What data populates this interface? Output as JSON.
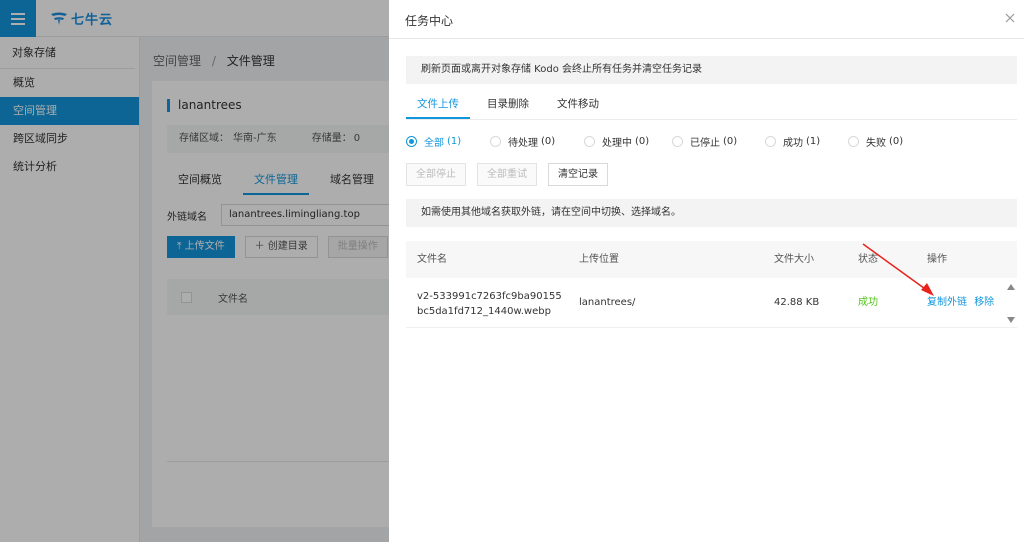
{
  "app": {
    "logo_text": "七牛云"
  },
  "sidebar": {
    "header": "对象存储",
    "items": [
      {
        "label": "概览"
      },
      {
        "label": "空间管理"
      },
      {
        "label": "跨区域同步"
      },
      {
        "label": "统计分析"
      }
    ]
  },
  "breadcrumb": {
    "parent": "空间管理",
    "separator": "/",
    "current": "文件管理"
  },
  "bucket": {
    "name": "lanantrees",
    "region_label": "存储区域：",
    "region": "华南-广东",
    "storage_label": "存储量：",
    "storage": "0"
  },
  "bucket_tabs": [
    "空间概览",
    "文件管理",
    "域名管理"
  ],
  "domain": {
    "label": "外链域名",
    "value": "lanantrees.limingliang.top"
  },
  "bucket_buttons": {
    "upload": "上传文件",
    "mkdir": "创建目录",
    "batch": "批量操作"
  },
  "bucket_table": {
    "col_filename": "文件名"
  },
  "drawer": {
    "title": "任务中心",
    "close_icon": "close-icon",
    "notice": "刷新页面或离开对象存储 Kodo 会终止所有任务并清空任务记录",
    "tabs": [
      "文件上传",
      "目录删除",
      "文件移动"
    ],
    "filters": [
      {
        "label": "全部",
        "count": "(1)"
      },
      {
        "label": "待处理",
        "count": "(0)"
      },
      {
        "label": "处理中",
        "count": "(0)"
      },
      {
        "label": "已停止",
        "count": "(0)"
      },
      {
        "label": "成功",
        "count": "(1)"
      },
      {
        "label": "失败",
        "count": "(0)"
      }
    ],
    "actions": {
      "stop_all": "全部停止",
      "retry_all": "全部重试",
      "clear": "清空记录"
    },
    "tip": "如需使用其他域名获取外链，请在空间中切换、选择域名。",
    "table": {
      "headers": {
        "name": "文件名",
        "location": "上传位置",
        "size": "文件大小",
        "status": "状态",
        "ops": "操作"
      },
      "rows": [
        {
          "name": "v2-533991c7263fc9ba90155bc5da1fd712_1440w.webp",
          "location": "lanantrees/",
          "size": "42.88 KB",
          "status": "成功",
          "op_copy": "复制外链",
          "op_remove": "移除"
        }
      ]
    }
  },
  "colors": {
    "accent": "#1296db",
    "success": "#52c41a",
    "annotation": "#e8231b"
  }
}
